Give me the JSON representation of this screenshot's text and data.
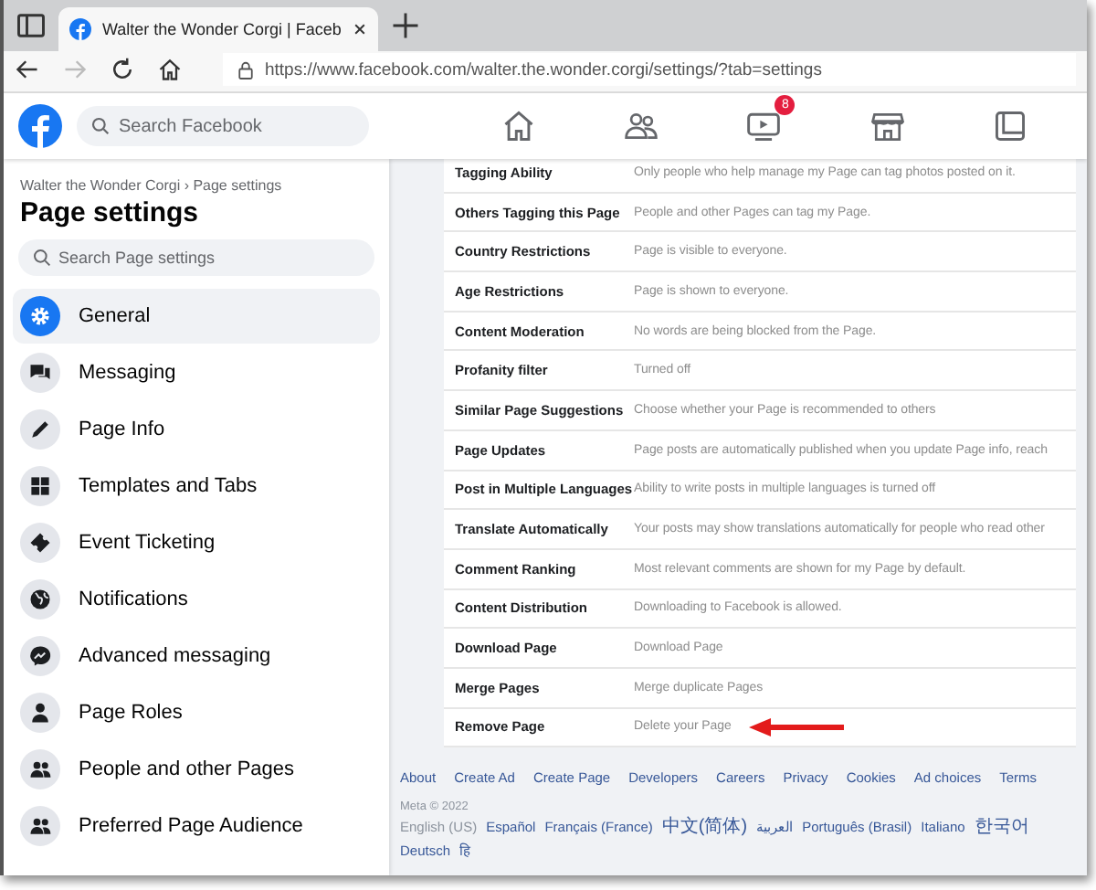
{
  "browser": {
    "tab_title": "Walter the Wonder Corgi | Faceb",
    "url": "https://www.facebook.com/walter.the.wonder.corgi/settings/?tab=settings"
  },
  "header": {
    "search_placeholder": "Search Facebook",
    "nav": [
      {
        "kind": "home"
      },
      {
        "kind": "friends"
      },
      {
        "kind": "watch",
        "badge": "8"
      },
      {
        "kind": "marketplace"
      },
      {
        "kind": "groups"
      }
    ]
  },
  "sidebar": {
    "breadcrumb": "Walter the Wonder Corgi › Page settings",
    "title": "Page settings",
    "search_placeholder": "Search Page settings",
    "items": [
      {
        "label": "General",
        "kind": "gear",
        "selected": true
      },
      {
        "label": "Messaging",
        "kind": "chat",
        "selected": false
      },
      {
        "label": "Page Info",
        "kind": "pencil",
        "selected": false
      },
      {
        "label": "Templates and Tabs",
        "kind": "grid",
        "selected": false
      },
      {
        "label": "Event Ticketing",
        "kind": "ticket",
        "selected": false
      },
      {
        "label": "Notifications",
        "kind": "globe",
        "selected": false
      },
      {
        "label": "Advanced messaging",
        "kind": "messenger",
        "selected": false
      },
      {
        "label": "Page Roles",
        "kind": "person",
        "selected": false
      },
      {
        "label": "People and other Pages",
        "kind": "people",
        "selected": false
      },
      {
        "label": "Preferred Page Audience",
        "kind": "people",
        "selected": false
      }
    ]
  },
  "settings": [
    {
      "label": "Tagging Ability",
      "value": "Only people who help manage my Page can tag photos posted on it."
    },
    {
      "label": "Others Tagging this Page",
      "value": "People and other Pages can tag my Page."
    },
    {
      "label": "Country Restrictions",
      "value": "Page is visible to everyone."
    },
    {
      "label": "Age Restrictions",
      "value": "Page is shown to everyone."
    },
    {
      "label": "Content Moderation",
      "value": "No words are being blocked from the Page."
    },
    {
      "label": "Profanity filter",
      "value": "Turned off"
    },
    {
      "label": "Similar Page Suggestions",
      "value": "Choose whether your Page is recommended to others"
    },
    {
      "label": "Page Updates",
      "value": "Page posts are automatically published when you update Page info, reach"
    },
    {
      "label": "Post in Multiple Languages",
      "value": "Ability to write posts in multiple languages is turned off"
    },
    {
      "label": "Translate Automatically",
      "value": "Your posts may show translations automatically for people who read other"
    },
    {
      "label": "Comment Ranking",
      "value": "Most relevant comments are shown for my Page by default."
    },
    {
      "label": "Content Distribution",
      "value": "Downloading to Facebook is allowed."
    },
    {
      "label": "Download Page",
      "value": "Download Page"
    },
    {
      "label": "Merge Pages",
      "value": "Merge duplicate Pages"
    },
    {
      "label": "Remove Page",
      "value": "Delete your Page",
      "annotated": true
    }
  ],
  "footer": {
    "links": [
      "About",
      "Create Ad",
      "Create Page",
      "Developers",
      "Careers",
      "Privacy",
      "Cookies",
      "Ad choices",
      "Terms"
    ],
    "copyright": "Meta © 2022",
    "languages": [
      {
        "label": "English (US)",
        "selected": true
      },
      {
        "label": "Español",
        "selected": false
      },
      {
        "label": "Français (France)",
        "selected": false
      },
      {
        "label": "中文(简体)",
        "selected": false
      },
      {
        "label": "العربية",
        "selected": false
      },
      {
        "label": "Português (Brasil)",
        "selected": false
      },
      {
        "label": "Italiano",
        "selected": false
      },
      {
        "label": "한국어",
        "selected": false
      },
      {
        "label": "Deutsch",
        "selected": false
      },
      {
        "label": "हि",
        "selected": false
      }
    ]
  }
}
